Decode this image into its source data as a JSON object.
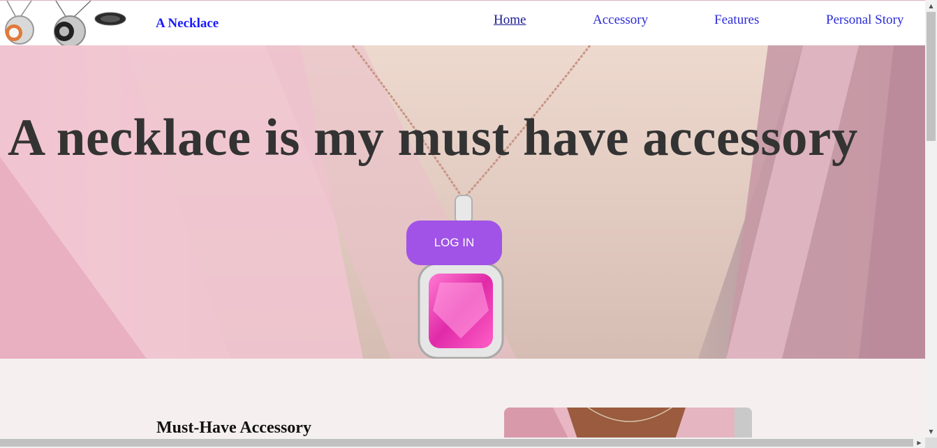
{
  "header": {
    "logo": "necklace-logo-image",
    "brand": "A Necklace",
    "nav": [
      {
        "label": "Home",
        "active": true
      },
      {
        "label": "Accessory",
        "active": false
      },
      {
        "label": "Features",
        "active": false
      },
      {
        "label": "Personal Story",
        "active": false
      }
    ]
  },
  "hero": {
    "title": "A necklace is my must have accessory",
    "button_label": "LOG IN",
    "image": "pink-gem-necklace-photo"
  },
  "section": {
    "title": "Must-Have Accessory",
    "image": "woman-wearing-necklace-photo"
  },
  "colors": {
    "brand": "#1a1aff",
    "nav": "#2b2bd6",
    "button": "#a053e6",
    "hero_title": "#333333"
  }
}
